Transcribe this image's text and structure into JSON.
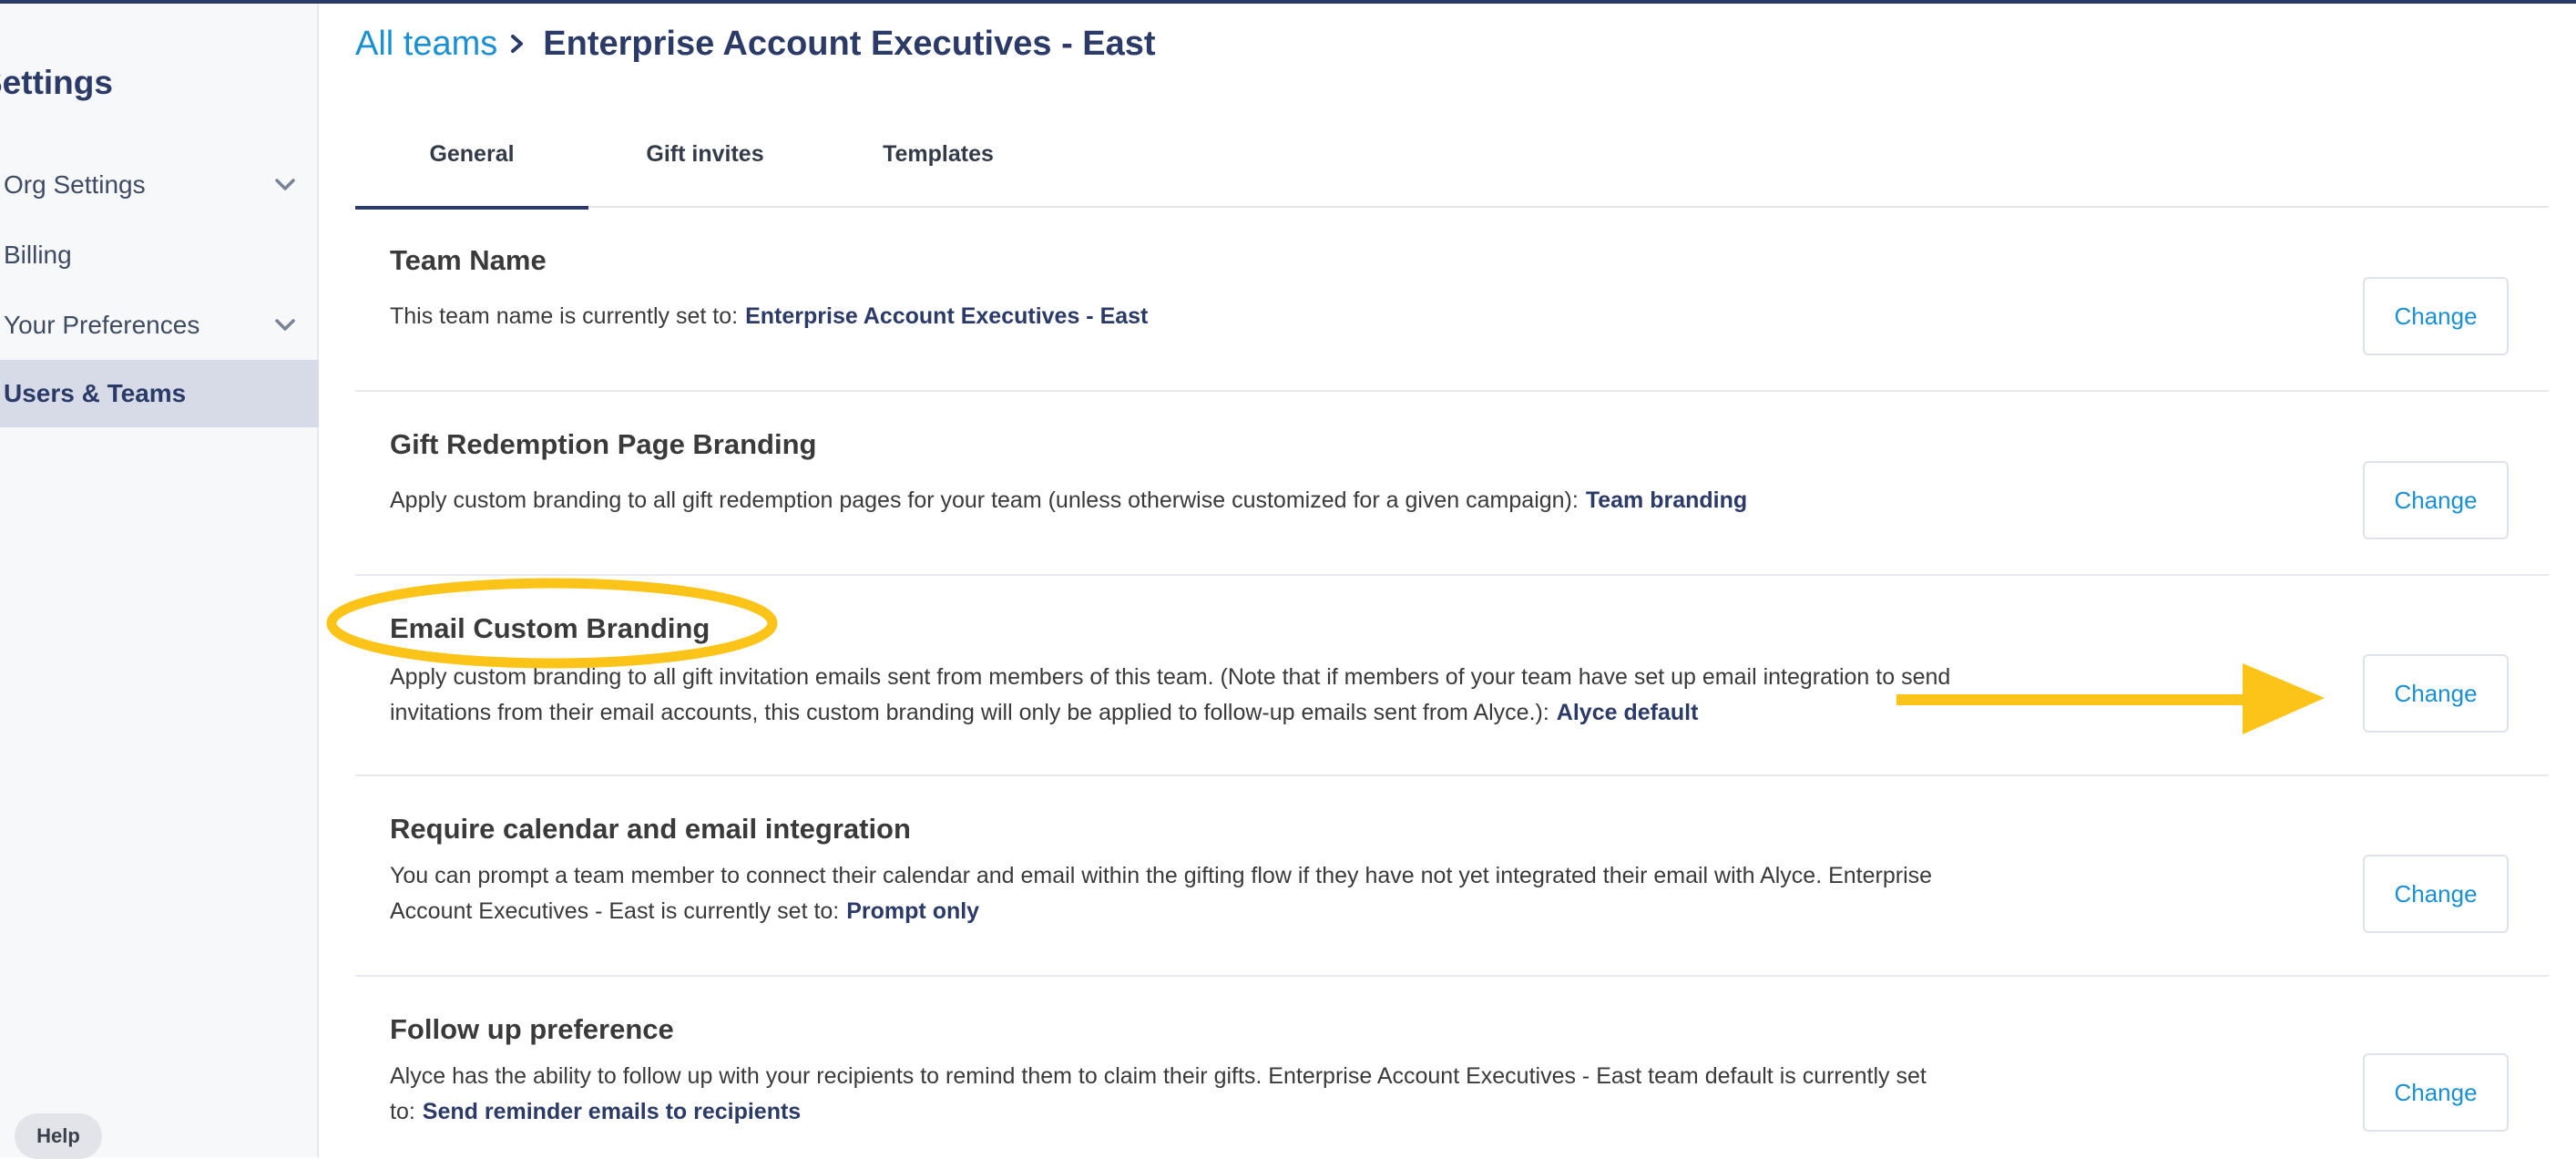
{
  "sidebar": {
    "title": "Settings",
    "items": [
      {
        "label": "Org Settings"
      },
      {
        "label": "Billing"
      },
      {
        "label": "Your Preferences"
      },
      {
        "label": "Users & Teams"
      }
    ],
    "help_label": "Help"
  },
  "breadcrumb": {
    "root": "All teams",
    "current": "Enterprise Account Executives - East"
  },
  "tabs": [
    {
      "label": "General"
    },
    {
      "label": "Gift invites"
    },
    {
      "label": "Templates"
    }
  ],
  "sections": [
    {
      "title": "Team Name",
      "description": "This team name is currently set to:",
      "value": "Enterprise Account Executives - East",
      "button": "Change"
    },
    {
      "title": "Gift Redemption Page Branding",
      "description": "Apply custom branding to all gift redemption pages for your team (unless otherwise customized for a given campaign):",
      "value": "Team branding",
      "button": "Change"
    },
    {
      "title": "Email Custom Branding",
      "description": "Apply custom branding to all gift invitation emails sent from members of this team. (Note that if members of your team have set up email integration to send invitations from their email accounts, this custom branding will only be applied to follow-up emails sent from Alyce.):",
      "value": "Alyce default",
      "button": "Change"
    },
    {
      "title": "Require calendar and email integration",
      "description": "You can prompt a team member to connect their calendar and email within the gifting flow if they have not yet integrated their email with Alyce. Enterprise Account Executives - East is currently set to:",
      "value": "Prompt only",
      "button": "Change"
    },
    {
      "title": "Follow up preference",
      "description": "Alyce has the ability to follow up with your recipients to remind them to claim their gifts. Enterprise Account Executives - East team default is currently set to:",
      "value": "Send reminder emails to recipients",
      "button": "Change"
    }
  ],
  "icons": {
    "chevron": "chevron-down-icon",
    "breadcrumb_separator": "chevron-right-icon"
  },
  "colors": {
    "brand_navy": "#2b3a67",
    "link_blue": "#1a8fd1",
    "annotation_yellow": "#fcc419",
    "active_nav_bg": "#d6dbe7"
  }
}
